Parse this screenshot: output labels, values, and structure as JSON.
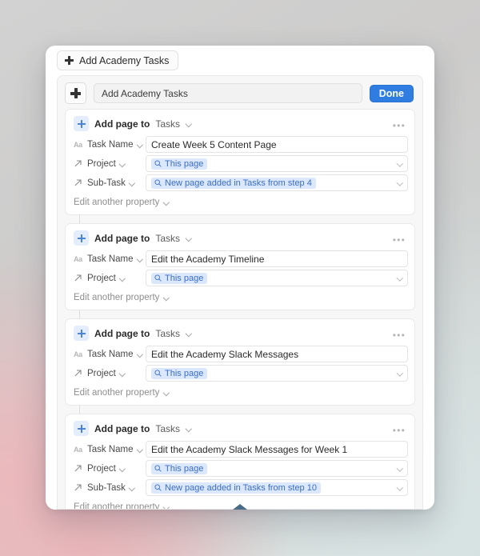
{
  "window": {
    "title_chip": {
      "label": "Add Academy Tasks",
      "icon": "plus-icon"
    },
    "header": {
      "add_button_icon": "plus-icon",
      "input_value": "Add Academy Tasks",
      "input_placeholder": "Add Academy Tasks",
      "done_label": "Done"
    }
  },
  "labels": {
    "action_text": "Add page to",
    "database_name": "Tasks",
    "edit_another_property": "Edit another property",
    "overflow_menu": "•••",
    "chevron_icon": "chevron-down-icon",
    "search_icon": "search-icon",
    "text_property_icon": "Aa",
    "relation_property_icon": "relation-arrow-icon"
  },
  "colors": {
    "accent_blue": "#2f7de1",
    "chip_blue_bg": "#dbe7fb",
    "chip_blue_text": "#3b6fc4",
    "plus_blue": "#4a83d8",
    "card_border": "#e9e9e9",
    "panel_bg": "#f7f7f7",
    "scroll_indicator": "#4a6d87"
  },
  "cards": [
    {
      "action": "Add page to",
      "database": "Tasks",
      "properties": [
        {
          "icon": "Aa",
          "icon_type": "text",
          "name": "Task Name",
          "type": "text",
          "value": "Create Week 5 Content Page"
        },
        {
          "icon": "relation-arrow-icon",
          "icon_type": "relation",
          "name": "Project",
          "type": "relation",
          "value": "This page"
        },
        {
          "icon": "relation-arrow-icon",
          "icon_type": "relation",
          "name": "Sub-Task",
          "type": "relation",
          "value": "New page added in Tasks from step 4"
        }
      ],
      "footer": "Edit another property"
    },
    {
      "action": "Add page to",
      "database": "Tasks",
      "properties": [
        {
          "icon": "Aa",
          "icon_type": "text",
          "name": "Task Name",
          "type": "text",
          "value": "Edit the Academy Timeline"
        },
        {
          "icon": "relation-arrow-icon",
          "icon_type": "relation",
          "name": "Project",
          "type": "relation",
          "value": "This page"
        }
      ],
      "footer": "Edit another property"
    },
    {
      "action": "Add page to",
      "database": "Tasks",
      "properties": [
        {
          "icon": "Aa",
          "icon_type": "text",
          "name": "Task Name",
          "type": "text",
          "value": "Edit the Academy Slack Messages"
        },
        {
          "icon": "relation-arrow-icon",
          "icon_type": "relation",
          "name": "Project",
          "type": "relation",
          "value": "This page"
        }
      ],
      "footer": "Edit another property"
    },
    {
      "action": "Add page to",
      "database": "Tasks",
      "properties": [
        {
          "icon": "Aa",
          "icon_type": "text",
          "name": "Task Name",
          "type": "text",
          "value": "Edit the Academy Slack Messages for Week 1"
        },
        {
          "icon": "relation-arrow-icon",
          "icon_type": "relation",
          "name": "Project",
          "type": "relation",
          "value": "This page"
        },
        {
          "icon": "relation-arrow-icon",
          "icon_type": "relation",
          "name": "Sub-Task",
          "type": "relation",
          "value": "New page added in Tasks from step 10"
        }
      ],
      "footer": "Edit another property"
    }
  ],
  "scroll_indicator": {
    "icon": "triangle-up-icon"
  }
}
